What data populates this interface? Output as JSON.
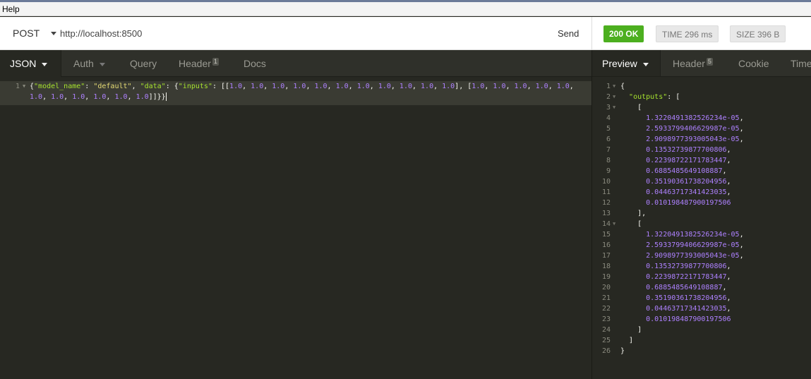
{
  "menu": {
    "help": "Help"
  },
  "request": {
    "method": "POST",
    "url": "http://localhost:8500",
    "send_label": "Send",
    "tabs": [
      {
        "label": "JSON",
        "active": true,
        "count": ""
      },
      {
        "label": "Auth",
        "active": false,
        "count": ""
      },
      {
        "label": "Query",
        "active": false,
        "count": ""
      },
      {
        "label": "Header",
        "active": false,
        "count": "1"
      },
      {
        "label": "Docs",
        "active": false,
        "count": ""
      }
    ],
    "body_line_number": "1",
    "body": "{\"model_name\": \"default\", \"data\": {\"inputs\": [[1.0, 1.0, 1.0, 1.0, 1.0, 1.0, 1.0, 1.0, 1.0, 1.0, 1.0], [1.0, 1.0, 1.0, 1.0, 1.0, 1.0, 1.0, 1.0, 1.0, 1.0, 1.0]]}}"
  },
  "response": {
    "status": "200 OK",
    "time": "TIME 296 ms",
    "size": "SIZE 396 B",
    "tabs": [
      {
        "label": "Preview",
        "active": true,
        "count": ""
      },
      {
        "label": "Header",
        "active": false,
        "count": "5"
      },
      {
        "label": "Cookie",
        "active": false,
        "count": ""
      },
      {
        "label": "Timeline",
        "active": false,
        "count": ""
      }
    ],
    "lines": [
      {
        "num": "1",
        "fold": true,
        "text": "{"
      },
      {
        "num": "2",
        "fold": true,
        "text": "  \"outputs\": ["
      },
      {
        "num": "3",
        "fold": true,
        "text": "    ["
      },
      {
        "num": "4",
        "fold": false,
        "text": "      1.3220491382526234e-05,"
      },
      {
        "num": "5",
        "fold": false,
        "text": "      2.5933799406629987e-05,"
      },
      {
        "num": "6",
        "fold": false,
        "text": "      2.9098977393005043e-05,"
      },
      {
        "num": "7",
        "fold": false,
        "text": "      0.13532739877700806,"
      },
      {
        "num": "8",
        "fold": false,
        "text": "      0.22398722171783447,"
      },
      {
        "num": "9",
        "fold": false,
        "text": "      0.6885485649108887,"
      },
      {
        "num": "10",
        "fold": false,
        "text": "      0.35190361738204956,"
      },
      {
        "num": "11",
        "fold": false,
        "text": "      0.04463717341423035,"
      },
      {
        "num": "12",
        "fold": false,
        "text": "      0.010198487900197506"
      },
      {
        "num": "13",
        "fold": false,
        "text": "    ],"
      },
      {
        "num": "14",
        "fold": true,
        "text": "    ["
      },
      {
        "num": "15",
        "fold": false,
        "text": "      1.3220491382526234e-05,"
      },
      {
        "num": "16",
        "fold": false,
        "text": "      2.5933799406629987e-05,"
      },
      {
        "num": "17",
        "fold": false,
        "text": "      2.9098977393005043e-05,"
      },
      {
        "num": "18",
        "fold": false,
        "text": "      0.13532739877700806,"
      },
      {
        "num": "19",
        "fold": false,
        "text": "      0.22398722171783447,"
      },
      {
        "num": "20",
        "fold": false,
        "text": "      0.6885485649108887,"
      },
      {
        "num": "21",
        "fold": false,
        "text": "      0.35190361738204956,"
      },
      {
        "num": "22",
        "fold": false,
        "text": "      0.04463717341423035,"
      },
      {
        "num": "23",
        "fold": false,
        "text": "      0.010198487900197506"
      },
      {
        "num": "24",
        "fold": false,
        "text": "    ]"
      },
      {
        "num": "25",
        "fold": false,
        "text": "  ]"
      },
      {
        "num": "26",
        "fold": false,
        "text": "}"
      }
    ]
  },
  "colors": {
    "status_ok": "#4caf1f",
    "editor_bg": "#272822",
    "key": "#a6e22e",
    "string": "#e6db74",
    "number": "#ae81ff"
  }
}
